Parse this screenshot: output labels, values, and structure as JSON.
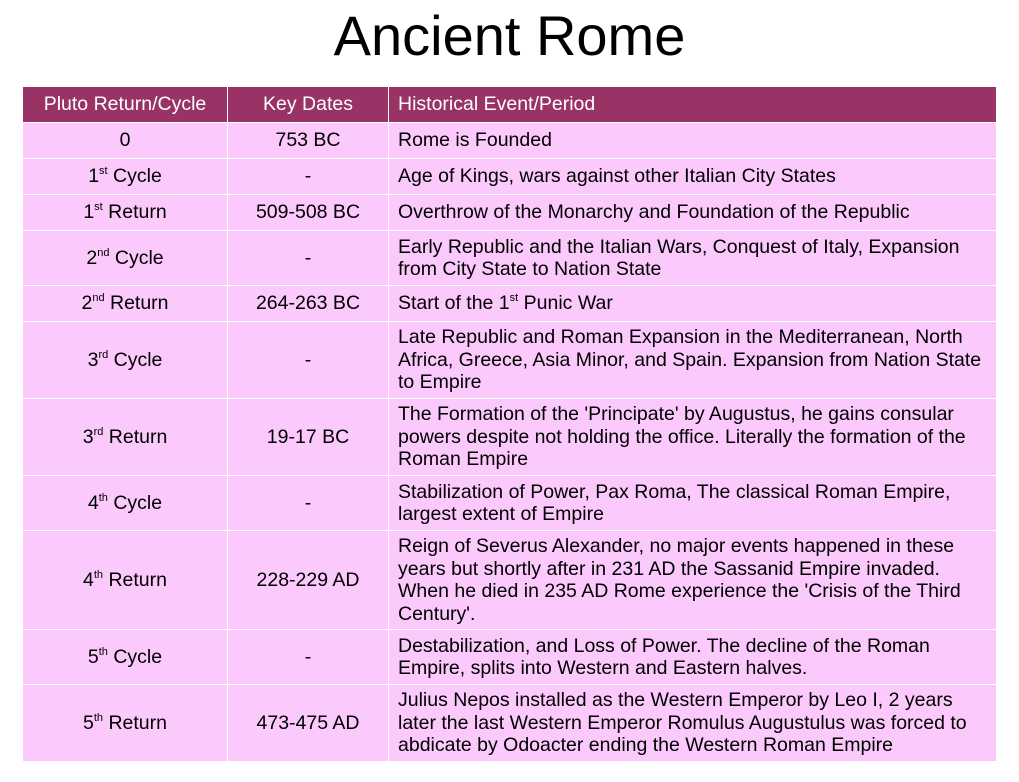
{
  "slide": {
    "title": "Ancient Rome"
  },
  "table": {
    "headers": {
      "cycle": "Pluto Return/Cycle",
      "dates": "Key Dates",
      "event": "Historical Event/Period"
    },
    "rows": [
      {
        "cycle_num": "0",
        "cycle_sup": "",
        "cycle_word": "",
        "dates": "753 BC",
        "event": "Rome is Founded",
        "event_sup": "",
        "event_tail": "",
        "height": 36
      },
      {
        "cycle_num": "1",
        "cycle_sup": "st",
        "cycle_word": " Cycle",
        "dates": "-",
        "event": "Age of Kings, wars against other Italian City States",
        "event_sup": "",
        "event_tail": "",
        "height": 36
      },
      {
        "cycle_num": "1",
        "cycle_sup": "st",
        "cycle_word": " Return",
        "dates": "509-508 BC",
        "event": "Overthrow of the Monarchy and Foundation of the Republic",
        "event_sup": "",
        "event_tail": "",
        "height": 36
      },
      {
        "cycle_num": "2",
        "cycle_sup": "nd",
        "cycle_word": " Cycle",
        "dates": "-",
        "event": "Early Republic and the Italian Wars, Conquest of Italy, Expansion from City State to Nation State",
        "event_sup": "",
        "event_tail": "",
        "height": 55
      },
      {
        "cycle_num": "2",
        "cycle_sup": "nd",
        "cycle_word": " Return",
        "dates": "264-263 BC",
        "event": "Start of the 1",
        "event_sup": "st",
        "event_tail": " Punic War",
        "height": 36
      },
      {
        "cycle_num": "3",
        "cycle_sup": "rd",
        "cycle_word": " Cycle",
        "dates": "-",
        "event": "Late Republic and Roman Expansion in the Mediterranean, North Africa, Greece, Asia Minor, and Spain. Expansion from Nation State to Empire",
        "event_sup": "",
        "event_tail": "",
        "height": 77
      },
      {
        "cycle_num": "3",
        "cycle_sup": "rd",
        "cycle_word": " Return",
        "dates": "19-17 BC",
        "event": "The Formation of the 'Principate' by Augustus, he gains consular powers despite not holding the office. Literally the formation of the Roman Empire",
        "event_sup": "",
        "event_tail": "",
        "height": 77
      },
      {
        "cycle_num": "4",
        "cycle_sup": "th",
        "cycle_word": " Cycle",
        "dates": "-",
        "event": "Stabilization of Power, Pax Roma, The classical Roman Empire, largest extent of Empire",
        "event_sup": "",
        "event_tail": "",
        "height": 55
      },
      {
        "cycle_num": "4",
        "cycle_sup": "th",
        "cycle_word": " Return",
        "dates": "228-229 AD",
        "event": "Reign of Severus Alexander, no major events happened in these years but shortly after in 231 AD the Sassanid Empire invaded. When he died in 235 AD Rome experience the 'Crisis of the Third Century'.",
        "event_sup": "",
        "event_tail": "",
        "height": 99
      },
      {
        "cycle_num": "5",
        "cycle_sup": "th",
        "cycle_word": " Cycle",
        "dates": "-",
        "event": "Destabilization, and Loss of Power. The decline of the Roman Empire, splits into Western and Eastern halves.",
        "event_sup": "",
        "event_tail": "",
        "height": 55
      },
      {
        "cycle_num": "5",
        "cycle_sup": "th",
        "cycle_word": " Return",
        "dates": "473-475 AD",
        "event": "Julius Nepos installed as the Western Emperor by Leo I, 2 years later the last Western Emperor Romulus Augustulus was forced to abdicate by Odoacter ending the Western Roman Empire",
        "event_sup": "",
        "event_tail": "",
        "height": 77
      }
    ]
  },
  "colors": {
    "header_bg": "#993366",
    "header_text": "#ffffff",
    "row_bg": "#fbc9fb",
    "border": "#ffffff"
  }
}
